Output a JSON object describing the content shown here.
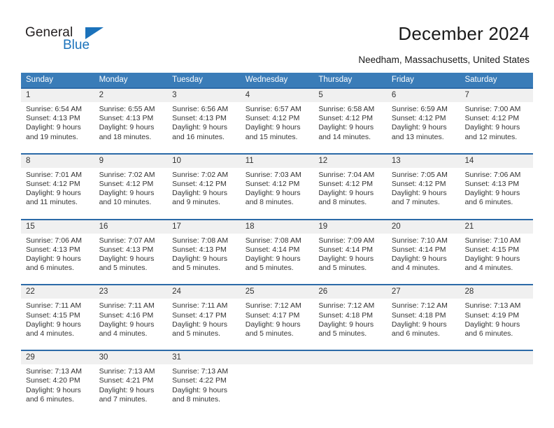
{
  "brand": {
    "name_dark": "General",
    "name_blue": "Blue",
    "accent_color": "#1b72bb"
  },
  "header": {
    "title": "December 2024",
    "subtitle": "Needham, Massachusetts, United States",
    "header_bg_color": "#3a7cb8",
    "row_rule_color": "#2c6aa8",
    "day_band_color": "#f0f0f0"
  },
  "weekdays": [
    "Sunday",
    "Monday",
    "Tuesday",
    "Wednesday",
    "Thursday",
    "Friday",
    "Saturday"
  ],
  "weeks": [
    [
      {
        "day": "1",
        "l1": "Sunrise: 6:54 AM",
        "l2": "Sunset: 4:13 PM",
        "l3": "Daylight: 9 hours",
        "l4": "and 19 minutes."
      },
      {
        "day": "2",
        "l1": "Sunrise: 6:55 AM",
        "l2": "Sunset: 4:13 PM",
        "l3": "Daylight: 9 hours",
        "l4": "and 18 minutes."
      },
      {
        "day": "3",
        "l1": "Sunrise: 6:56 AM",
        "l2": "Sunset: 4:13 PM",
        "l3": "Daylight: 9 hours",
        "l4": "and 16 minutes."
      },
      {
        "day": "4",
        "l1": "Sunrise: 6:57 AM",
        "l2": "Sunset: 4:12 PM",
        "l3": "Daylight: 9 hours",
        "l4": "and 15 minutes."
      },
      {
        "day": "5",
        "l1": "Sunrise: 6:58 AM",
        "l2": "Sunset: 4:12 PM",
        "l3": "Daylight: 9 hours",
        "l4": "and 14 minutes."
      },
      {
        "day": "6",
        "l1": "Sunrise: 6:59 AM",
        "l2": "Sunset: 4:12 PM",
        "l3": "Daylight: 9 hours",
        "l4": "and 13 minutes."
      },
      {
        "day": "7",
        "l1": "Sunrise: 7:00 AM",
        "l2": "Sunset: 4:12 PM",
        "l3": "Daylight: 9 hours",
        "l4": "and 12 minutes."
      }
    ],
    [
      {
        "day": "8",
        "l1": "Sunrise: 7:01 AM",
        "l2": "Sunset: 4:12 PM",
        "l3": "Daylight: 9 hours",
        "l4": "and 11 minutes."
      },
      {
        "day": "9",
        "l1": "Sunrise: 7:02 AM",
        "l2": "Sunset: 4:12 PM",
        "l3": "Daylight: 9 hours",
        "l4": "and 10 minutes."
      },
      {
        "day": "10",
        "l1": "Sunrise: 7:02 AM",
        "l2": "Sunset: 4:12 PM",
        "l3": "Daylight: 9 hours",
        "l4": "and 9 minutes."
      },
      {
        "day": "11",
        "l1": "Sunrise: 7:03 AM",
        "l2": "Sunset: 4:12 PM",
        "l3": "Daylight: 9 hours",
        "l4": "and 8 minutes."
      },
      {
        "day": "12",
        "l1": "Sunrise: 7:04 AM",
        "l2": "Sunset: 4:12 PM",
        "l3": "Daylight: 9 hours",
        "l4": "and 8 minutes."
      },
      {
        "day": "13",
        "l1": "Sunrise: 7:05 AM",
        "l2": "Sunset: 4:12 PM",
        "l3": "Daylight: 9 hours",
        "l4": "and 7 minutes."
      },
      {
        "day": "14",
        "l1": "Sunrise: 7:06 AM",
        "l2": "Sunset: 4:13 PM",
        "l3": "Daylight: 9 hours",
        "l4": "and 6 minutes."
      }
    ],
    [
      {
        "day": "15",
        "l1": "Sunrise: 7:06 AM",
        "l2": "Sunset: 4:13 PM",
        "l3": "Daylight: 9 hours",
        "l4": "and 6 minutes."
      },
      {
        "day": "16",
        "l1": "Sunrise: 7:07 AM",
        "l2": "Sunset: 4:13 PM",
        "l3": "Daylight: 9 hours",
        "l4": "and 5 minutes."
      },
      {
        "day": "17",
        "l1": "Sunrise: 7:08 AM",
        "l2": "Sunset: 4:13 PM",
        "l3": "Daylight: 9 hours",
        "l4": "and 5 minutes."
      },
      {
        "day": "18",
        "l1": "Sunrise: 7:08 AM",
        "l2": "Sunset: 4:14 PM",
        "l3": "Daylight: 9 hours",
        "l4": "and 5 minutes."
      },
      {
        "day": "19",
        "l1": "Sunrise: 7:09 AM",
        "l2": "Sunset: 4:14 PM",
        "l3": "Daylight: 9 hours",
        "l4": "and 5 minutes."
      },
      {
        "day": "20",
        "l1": "Sunrise: 7:10 AM",
        "l2": "Sunset: 4:14 PM",
        "l3": "Daylight: 9 hours",
        "l4": "and 4 minutes."
      },
      {
        "day": "21",
        "l1": "Sunrise: 7:10 AM",
        "l2": "Sunset: 4:15 PM",
        "l3": "Daylight: 9 hours",
        "l4": "and 4 minutes."
      }
    ],
    [
      {
        "day": "22",
        "l1": "Sunrise: 7:11 AM",
        "l2": "Sunset: 4:15 PM",
        "l3": "Daylight: 9 hours",
        "l4": "and 4 minutes."
      },
      {
        "day": "23",
        "l1": "Sunrise: 7:11 AM",
        "l2": "Sunset: 4:16 PM",
        "l3": "Daylight: 9 hours",
        "l4": "and 4 minutes."
      },
      {
        "day": "24",
        "l1": "Sunrise: 7:11 AM",
        "l2": "Sunset: 4:17 PM",
        "l3": "Daylight: 9 hours",
        "l4": "and 5 minutes."
      },
      {
        "day": "25",
        "l1": "Sunrise: 7:12 AM",
        "l2": "Sunset: 4:17 PM",
        "l3": "Daylight: 9 hours",
        "l4": "and 5 minutes."
      },
      {
        "day": "26",
        "l1": "Sunrise: 7:12 AM",
        "l2": "Sunset: 4:18 PM",
        "l3": "Daylight: 9 hours",
        "l4": "and 5 minutes."
      },
      {
        "day": "27",
        "l1": "Sunrise: 7:12 AM",
        "l2": "Sunset: 4:18 PM",
        "l3": "Daylight: 9 hours",
        "l4": "and 6 minutes."
      },
      {
        "day": "28",
        "l1": "Sunrise: 7:13 AM",
        "l2": "Sunset: 4:19 PM",
        "l3": "Daylight: 9 hours",
        "l4": "and 6 minutes."
      }
    ],
    [
      {
        "day": "29",
        "l1": "Sunrise: 7:13 AM",
        "l2": "Sunset: 4:20 PM",
        "l3": "Daylight: 9 hours",
        "l4": "and 6 minutes."
      },
      {
        "day": "30",
        "l1": "Sunrise: 7:13 AM",
        "l2": "Sunset: 4:21 PM",
        "l3": "Daylight: 9 hours",
        "l4": "and 7 minutes."
      },
      {
        "day": "31",
        "l1": "Sunrise: 7:13 AM",
        "l2": "Sunset: 4:22 PM",
        "l3": "Daylight: 9 hours",
        "l4": "and 8 minutes."
      },
      {
        "day": "",
        "l1": "",
        "l2": "",
        "l3": "",
        "l4": ""
      },
      {
        "day": "",
        "l1": "",
        "l2": "",
        "l3": "",
        "l4": ""
      },
      {
        "day": "",
        "l1": "",
        "l2": "",
        "l3": "",
        "l4": ""
      },
      {
        "day": "",
        "l1": "",
        "l2": "",
        "l3": "",
        "l4": ""
      }
    ]
  ]
}
